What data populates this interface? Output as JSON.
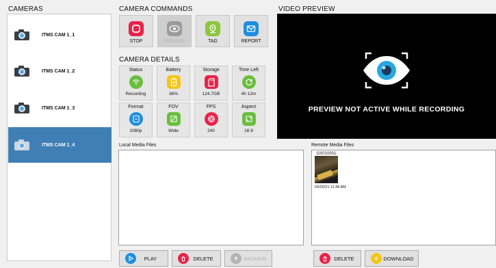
{
  "cameras": {
    "title": "CAMERAS",
    "items": [
      {
        "label": "ITMS CAM 1_1",
        "selected": false
      },
      {
        "label": "ITMS CAM 1_2",
        "selected": false
      },
      {
        "label": "ITMS CAM 1_3",
        "selected": false
      },
      {
        "label": "ITMS CAM 1_4",
        "selected": true
      }
    ]
  },
  "commands": {
    "title": "CAMERA COMMANDS",
    "buttons": [
      {
        "label": "STOP",
        "icon": "stop-icon",
        "enabled": true,
        "color": "#e8234a"
      },
      {
        "label": "PREVIEW",
        "icon": "eye-icon",
        "enabled": false,
        "color": "#9b9b9b"
      },
      {
        "label": "TAG",
        "icon": "location-pin-icon",
        "enabled": true,
        "color": "#8cc63f"
      },
      {
        "label": "REPORT",
        "icon": "mail-icon",
        "enabled": true,
        "color": "#1f8ee0"
      }
    ]
  },
  "details": {
    "title": "CAMERA DETAILS",
    "tiles": [
      {
        "title": "Status",
        "value": "Recording",
        "icon": "wifi-icon",
        "color": "#6abe3f"
      },
      {
        "title": "Battery",
        "value": "36%",
        "icon": "battery-icon",
        "color": "#f5c518"
      },
      {
        "title": "Storage",
        "value": "124.7GB",
        "icon": "sd-card-icon",
        "color": "#e8234a"
      },
      {
        "title": "Time Left",
        "value": "4h 12m",
        "icon": "refresh-icon",
        "color": "#6abe3f"
      },
      {
        "title": "Format",
        "value": "1080p",
        "icon": "film-icon",
        "color": "#1f8ee0"
      },
      {
        "title": "FOV",
        "value": "Wide",
        "icon": "crop-icon",
        "color": "#6abe3f"
      },
      {
        "title": "FPS",
        "value": "240",
        "icon": "aperture-icon",
        "color": "#e8234a"
      },
      {
        "title": "Aspect",
        "value": "16:9",
        "icon": "aspect-ratio-icon",
        "color": "#6abe3f"
      }
    ]
  },
  "preview": {
    "title": "VIDEO PREVIEW",
    "message": "PREVIEW NOT ACTIVE WHILE RECORDING",
    "icon": "eye-focus-icon",
    "accent": "#28a8e0"
  },
  "local_media": {
    "title": "Local Media Files",
    "buttons": [
      {
        "label": "PLAY",
        "icon": "play-icon",
        "enabled": true,
        "color": "#1f8ee0"
      },
      {
        "label": "DELETE",
        "icon": "trash-icon",
        "enabled": true,
        "color": "#e8234a"
      },
      {
        "label": "ARCHIVE",
        "icon": "upload-icon",
        "enabled": false,
        "color": "#b5b5b5"
      }
    ]
  },
  "remote_media": {
    "title": "Remote Media Files",
    "files": [
      {
        "name": "GX010001",
        "date": "03/26/21 11:48 AM"
      }
    ],
    "buttons": [
      {
        "label": "DELETE",
        "icon": "trash-icon",
        "enabled": true,
        "color": "#e8234a"
      },
      {
        "label": "DOWNLOAD",
        "icon": "download-icon",
        "enabled": true,
        "color": "#f5c518"
      }
    ]
  }
}
